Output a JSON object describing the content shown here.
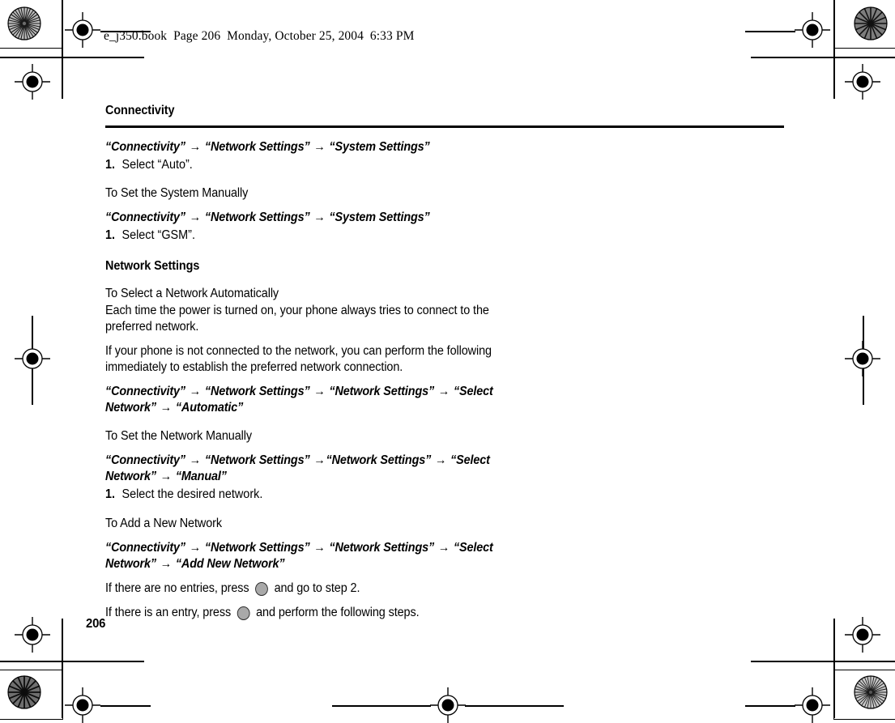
{
  "print_header": {
    "text": "e_j350.book  Page 206  Monday, October 25, 2004  6:33 PM"
  },
  "chapter": {
    "title": "Connectivity"
  },
  "page_number": "206",
  "arrow_glyph": "→",
  "key_icon_name": "center-key-icon",
  "colors": {
    "text": "#000000",
    "rule": "#000000",
    "key_icon_fill": "#a9a9a9",
    "key_icon_stroke": "#2b2b2b",
    "page_background": "#ffffff"
  },
  "blocks": {
    "path_system_auto": {
      "segments": [
        "“Connectivity”",
        "“Network Settings”",
        "“System Settings”"
      ]
    },
    "step_auto": {
      "num": "1.",
      "text": "Select “Auto”."
    },
    "subhead_system_manual": "To Set the System Manually",
    "path_system_gsm": {
      "segments": [
        "“Connectivity”",
        "“Network Settings”",
        "“System Settings”"
      ]
    },
    "step_gsm": {
      "num": "1.",
      "text": "Select “GSM”."
    },
    "section_network_settings": "Network Settings",
    "subhead_select_auto": "To Select a Network Automatically",
    "para_each_time": "Each time the power is turned on, your phone always tries to connect to the preferred network.",
    "para_if_not_connected": "If your phone is not connected to the network, you can perform the following immediately to establish the preferred network connection.",
    "path_automatic": {
      "segments": [
        "“Connectivity”",
        "“Network Settings”",
        "“Network Settings”",
        "“Select Network”",
        "“Automatic”"
      ]
    },
    "subhead_network_manual": "To Set the Network Manually",
    "path_manual": {
      "segments": [
        "“Connectivity”",
        "“Network Settings”",
        "“Network Settings”",
        "“Select Network”",
        "“Manual”"
      ]
    },
    "step_desired_network": {
      "num": "1.",
      "text": "Select the desired network."
    },
    "subhead_add_new": "To Add a New Network",
    "path_add_new": {
      "segments": [
        "“Connectivity”",
        "“Network Settings”",
        "“Network Settings”",
        "“Select Network”",
        "“Add New Network”"
      ]
    },
    "press_no_entries": {
      "before": "If there are no entries, press ",
      "after": " and go to step 2."
    },
    "press_an_entry": {
      "before": "If there is an entry, press ",
      "after": " and perform the following steps."
    }
  }
}
